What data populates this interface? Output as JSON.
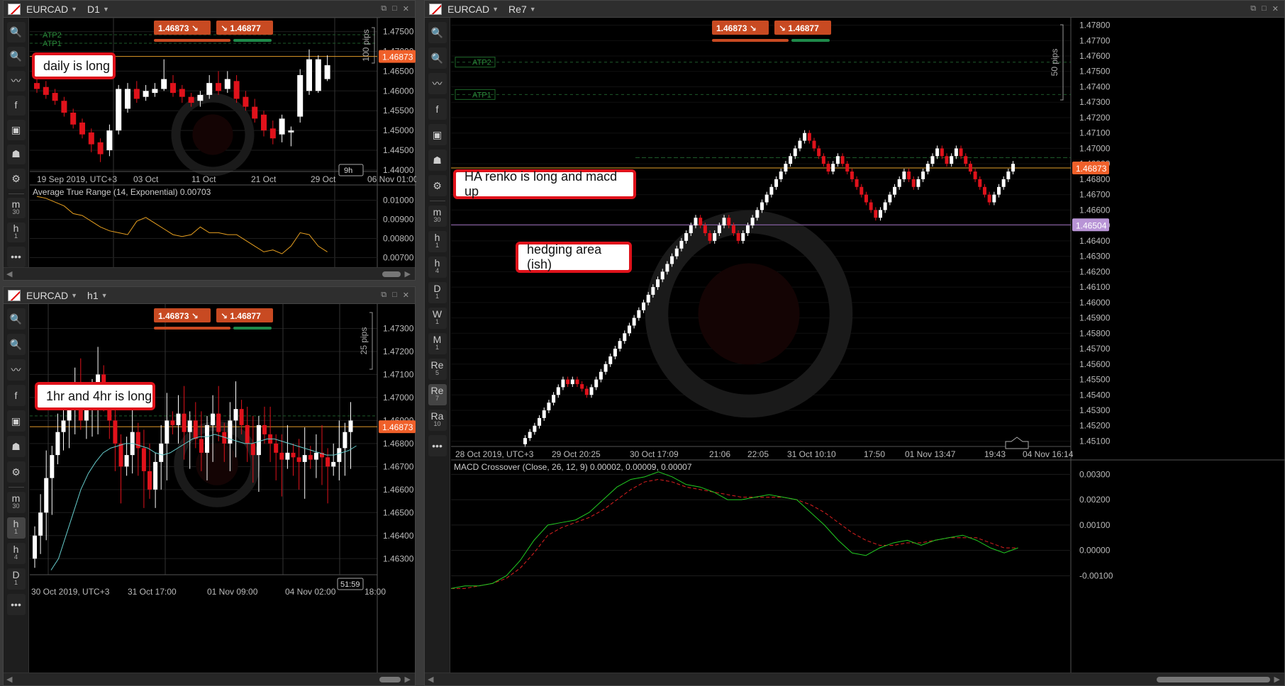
{
  "symbol": "EURCAD",
  "quote": {
    "sell": "1.4687",
    "sell_pip": "3",
    "buy": "1.4687",
    "buy_pip": "7"
  },
  "panels": {
    "tl": {
      "timeframe": "D1",
      "xticks": [
        "19 Sep 2019, UTC+3",
        "03 Oct",
        "11 Oct",
        "21 Oct",
        "29 Oct",
        "06 Nov 01:00"
      ],
      "yticks": [
        "1.47500",
        "1.47000",
        "1.46500",
        "1.46000",
        "1.45500",
        "1.45000",
        "1.44500",
        "1.44000"
      ],
      "price_tag": "1.46873",
      "pips_label": "100 pips",
      "timer": "9h",
      "atp2": "ATP2",
      "atp1": "ATP1",
      "indicator_label": "Average True Range (14, Exponential) 0.00703",
      "ind_ticks": [
        "0.01000",
        "0.00900",
        "0.00800",
        "0.00700"
      ],
      "note": "daily is long"
    },
    "bl": {
      "timeframe": "h1",
      "xticks": [
        "30 Oct 2019, UTC+3",
        "31 Oct 17:00",
        "01 Nov 09:00",
        "04 Nov 02:00",
        "18:00"
      ],
      "yticks": [
        "1.47300",
        "1.47200",
        "1.47100",
        "1.47000",
        "1.46900",
        "1.46800",
        "1.46700",
        "1.46600",
        "1.46500",
        "1.46400",
        "1.46300"
      ],
      "price_tag": "1.46873",
      "pips_label": "25 pips",
      "timer": "51:59",
      "note": "1hr and 4hr is long"
    },
    "right": {
      "timeframe": "Re7",
      "xticks": [
        "28 Oct 2019, UTC+3",
        "29 Oct 20:25",
        "30 Oct 17:09",
        "21:06",
        "22:05",
        "31 Oct 10:10",
        "17:50",
        "01 Nov 13:47",
        "19:43",
        "04 Nov 16:14"
      ],
      "yticks": [
        "1.47800",
        "1.47700",
        "1.47600",
        "1.47500",
        "1.47400",
        "1.47300",
        "1.47200",
        "1.47100",
        "1.47000",
        "1.46900",
        "1.46800",
        "1.46700",
        "1.46600",
        "1.46500",
        "1.46400",
        "1.46300",
        "1.46200",
        "1.46100",
        "1.46000",
        "1.45900",
        "1.45800",
        "1.45700",
        "1.45600",
        "1.45500",
        "1.45400",
        "1.45300",
        "1.45200",
        "1.45100"
      ],
      "price_tag": "1.46873",
      "hedge_tag": "1.46504",
      "pips_label": "50 pips",
      "atp2": "ATP2",
      "atp1": "ATP1",
      "indicator_label": "MACD Crossover (Close, 26, 12, 9) 0.00002, 0.00009, 0.00007",
      "ind_ticks": [
        "0.00300",
        "0.00200",
        "0.00100",
        "0.00000",
        "-0.00100"
      ],
      "note1": "HA renko is long and macd up",
      "note2": "hedging area (ish)"
    }
  },
  "toolbar_left": [
    "zoom-in",
    "zoom-out",
    "indicators",
    "facebook",
    "cbot",
    "trader",
    "settings"
  ],
  "tf_tl": [
    {
      "t": "m",
      "s": "30"
    },
    {
      "t": "h",
      "s": "1"
    }
  ],
  "tf_bl": [
    {
      "t": "m",
      "s": "30"
    },
    {
      "t": "h",
      "s": "1"
    },
    {
      "t": "h",
      "s": "4"
    },
    {
      "t": "D",
      "s": "1"
    }
  ],
  "tf_right": [
    {
      "t": "m",
      "s": "30"
    },
    {
      "t": "h",
      "s": "1"
    },
    {
      "t": "h",
      "s": "4"
    },
    {
      "t": "D",
      "s": "1"
    },
    {
      "t": "W",
      "s": "1"
    },
    {
      "t": "M",
      "s": "1"
    },
    {
      "t": "Re",
      "s": "5"
    },
    {
      "t": "Re",
      "s": "7"
    },
    {
      "t": "Ra",
      "s": "10"
    }
  ],
  "colors": {
    "bull": "#ffffff",
    "bear": "#e0121b",
    "price": "#f0602a",
    "hedge": "#9e6fbf",
    "grid": "#1e1e1e",
    "macd": "#22cc22",
    "signal": "#e02020",
    "atr": "#e8a020",
    "ma": "#66cccc"
  }
}
